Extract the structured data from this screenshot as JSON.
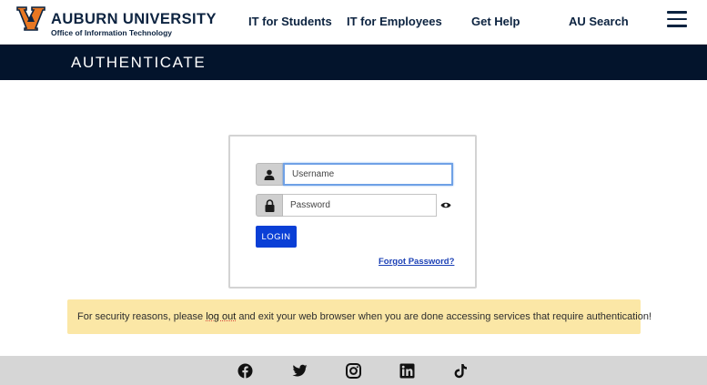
{
  "header": {
    "brand_title": "AUBURN UNIVERSITY",
    "brand_subtitle": "Office of Information Technology",
    "nav": [
      {
        "label": "IT for Students"
      },
      {
        "label": "IT for Employees"
      },
      {
        "label": "Get Help"
      },
      {
        "label": "AU Search"
      }
    ],
    "menu_icon": "hamburger-icon"
  },
  "banner": {
    "title": "AUTHENTICATE"
  },
  "login": {
    "username_placeholder": "Username",
    "username_value": "",
    "password_placeholder": "Password",
    "password_value": "",
    "login_label": "LOGIN",
    "forgot_label": "Forgot Password?",
    "icons": [
      "user-icon",
      "lock-icon",
      "eye-icon"
    ]
  },
  "notice": {
    "before": "For security reasons, please ",
    "link": "log out",
    "after": " and exit your web browser when you are done accessing services that require authentication!"
  },
  "footer": {
    "social": [
      "facebook-icon",
      "twitter-icon",
      "instagram-icon",
      "linkedin-icon",
      "tiktok-icon"
    ]
  },
  "colors": {
    "navy": "#0c2340",
    "banner_bg": "#03142c",
    "login_button": "#0a3fd6",
    "notice_bg": "#fbe7a6",
    "footer_bg": "#d6d6d6"
  }
}
